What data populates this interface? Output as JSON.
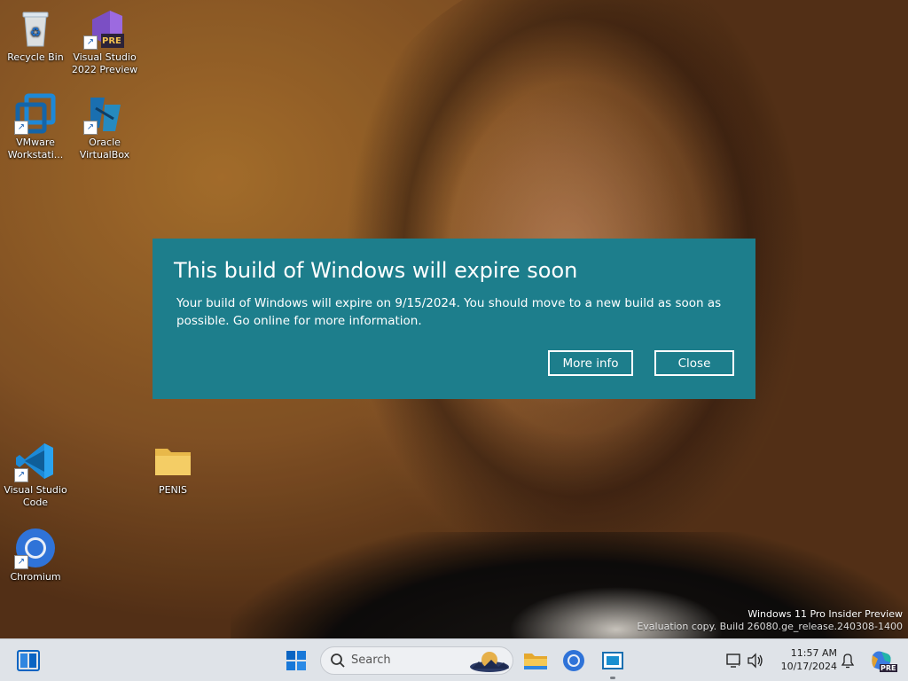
{
  "desktop": {
    "icons": [
      {
        "label": "Recycle Bin",
        "icon": "recycle-bin-icon"
      },
      {
        "label": "Visual Studio 2022 Preview",
        "icon": "visual-studio-preview-icon",
        "badge": "PRE"
      },
      {
        "label": "VMware Workstati...",
        "icon": "vmware-icon"
      },
      {
        "label": "Oracle VirtualBox",
        "icon": "virtualbox-icon"
      },
      {
        "label": "Visual Studio Code",
        "icon": "vscode-icon"
      },
      {
        "label": "PENIS",
        "icon": "folder-icon"
      },
      {
        "label": "Chromium",
        "icon": "chromium-icon"
      }
    ]
  },
  "dialog": {
    "title": "This build of Windows will expire soon",
    "body": "Your build of Windows will expire on 9/15/2024. You should move to a new build as soon as possible. Go online for more information.",
    "more_info_label": "More info",
    "close_label": "Close",
    "background": "#1d7e8c"
  },
  "watermark": {
    "line1": "Windows 11 Pro Insider Preview",
    "line2": "Evaluation copy. Build 26080.ge_release.240308-1400"
  },
  "taskbar": {
    "search_placeholder": "Search",
    "time": "11:57 AM",
    "date": "10/17/2024",
    "copilot_badge": "PRE"
  },
  "colors": {
    "dialog_bg": "#1d7e8c",
    "taskbar_bg": "#dfe3e8",
    "accent": "#0a64c2"
  }
}
